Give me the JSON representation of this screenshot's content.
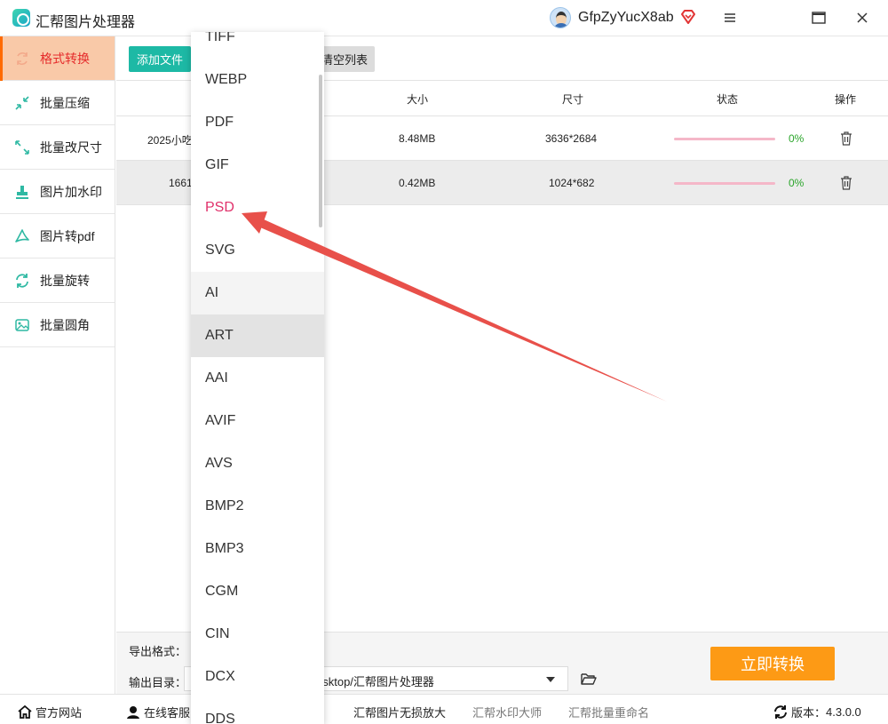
{
  "app": {
    "title": "汇帮图片处理器",
    "username": "GfpZyYucX8ab"
  },
  "sidebar": {
    "items": [
      {
        "label": "格式转换",
        "icon": "format-convert-icon"
      },
      {
        "label": "批量压缩",
        "icon": "compress-icon"
      },
      {
        "label": "批量改尺寸",
        "icon": "resize-icon"
      },
      {
        "label": "图片加水印",
        "icon": "watermark-icon"
      },
      {
        "label": "图片转pdf",
        "icon": "pdf-icon"
      },
      {
        "label": "批量旋转",
        "icon": "rotate-icon"
      },
      {
        "label": "批量圆角",
        "icon": "round-corner-icon"
      }
    ]
  },
  "toolbar": {
    "add_label": "添加文件",
    "clear_label": "清空列表"
  },
  "table": {
    "headers": {
      "size": "大小",
      "dims": "尺寸",
      "status": "状态",
      "ops": "操作"
    },
    "rows": [
      {
        "name": "2025小吃",
        "size": "8.48MB",
        "dims": "3636*2684",
        "progress": "0%"
      },
      {
        "name": "1661",
        "size": "0.42MB",
        "dims": "1024*682",
        "progress": "0%"
      }
    ]
  },
  "bottom": {
    "format_label": "导出格式：",
    "dir_label": "输出目录：",
    "dir_value": "esktop/汇帮图片处理器",
    "convert_label": "立即转换"
  },
  "statusbar": {
    "website": "官方网站",
    "support": "在线客服",
    "upscale": "汇帮图片无损放大",
    "watermark_master": "汇帮水印大师",
    "rename": "汇帮批量重命名",
    "version_label": "版本：",
    "version": "4.3.0.0"
  },
  "dropdown": {
    "options": [
      "TIFF",
      "WEBP",
      "PDF",
      "GIF",
      "PSD",
      "SVG",
      "AI",
      "ART",
      "AAI",
      "AVIF",
      "AVS",
      "BMP2",
      "BMP3",
      "CGM",
      "CIN",
      "DCX",
      "DDS"
    ],
    "selected": "PSD",
    "hover_light": "AI",
    "hover_dark": "ART"
  },
  "colors": {
    "accent_teal": "#1db9a5",
    "active_tab_bg": "#f9c9a8",
    "active_tab_text": "#e52b2b",
    "convert_button": "#fd9a15",
    "selected_option": "#e0306a",
    "progress_text": "#2aa52a",
    "annotation_arrow": "#e8504a"
  }
}
